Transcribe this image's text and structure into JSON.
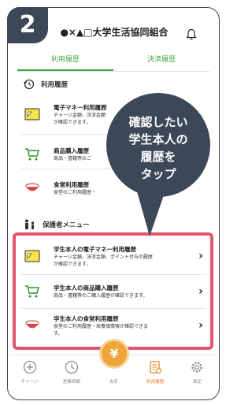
{
  "step_number": "2",
  "app": {
    "title": "●×▲□大学生活協同組合"
  },
  "tabs": [
    {
      "label": "利用履歴",
      "active": true
    },
    {
      "label": "決済履歴",
      "active": false
    }
  ],
  "usage_section": {
    "title": "利用履歴",
    "items": [
      {
        "title": "電子マネー利用履歴",
        "desc": "チャージ金額、決済金額",
        "desc2": "が確認できます。"
      },
      {
        "title": "商品購入履歴",
        "desc": "商品・書籍等のご",
        "desc2": ""
      },
      {
        "title": "食堂利用履歴",
        "desc": "食堂のご利用履歴・",
        "desc2": ""
      }
    ]
  },
  "guardian_section": {
    "title": "保護者メニュー",
    "items": [
      {
        "title": "学生本人の電子マネー利用履歴",
        "desc": "チャージ金額、決済金額、ポイント付与の履歴",
        "desc2": "が確認できます。"
      },
      {
        "title": "学生本人の商品購入履歴",
        "desc": "商品・書籍等のご購入履歴が確認できます。",
        "desc2": ""
      },
      {
        "title": "学生本人の食堂利用履歴",
        "desc": "食堂のご利用履歴・栄養価情報が確認できま",
        "desc2": "す。"
      }
    ]
  },
  "callout": {
    "line1": "確認したい",
    "line2": "学生本人の",
    "line3": "履歴を",
    "line4": "タップ"
  },
  "bottom_nav": {
    "items": [
      {
        "label": "チャージ",
        "icon": "plus-circle-icon"
      },
      {
        "label": "営業時間",
        "icon": "clock-icon"
      },
      {
        "label": "決済",
        "icon": "yen-icon"
      },
      {
        "label": "利用履歴",
        "icon": "history-icon",
        "active": true
      },
      {
        "label": "設定",
        "icon": "gear-icon"
      }
    ],
    "pay_symbol": "¥"
  },
  "colors": {
    "accent_green": "#4aa54a",
    "highlight": "#e0566c",
    "bubble": "#3c4858",
    "pay_orange": "#f0a53a"
  }
}
